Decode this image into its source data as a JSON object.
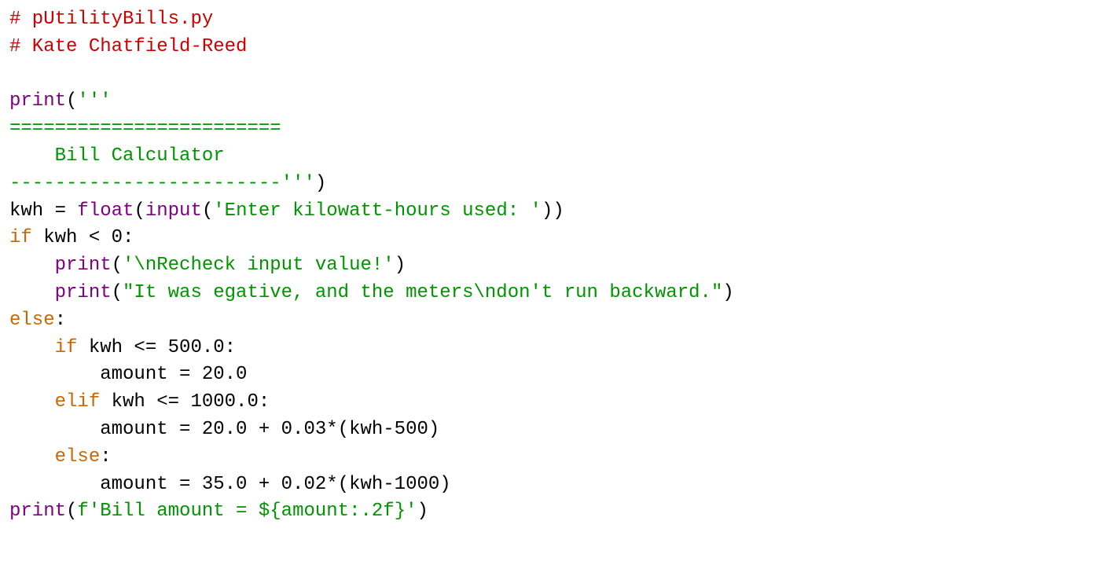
{
  "code": {
    "comment1": "# pUtilityBills.py",
    "comment2": "# Kate Chatfield-Reed",
    "blank1": "",
    "l4": {
      "print": "print",
      "paren_open": "(",
      "str": "'''"
    },
    "l5": {
      "str": "========================"
    },
    "l6": {
      "str": "    Bill Calculator"
    },
    "l7": {
      "str": "------------------------'''",
      "paren_close": ")"
    },
    "l8": {
      "lhs": "kwh = ",
      "float": "float",
      "paren1": "(",
      "input": "input",
      "paren2": "(",
      "str": "'Enter kilowatt-hours used: '",
      "close": "))"
    },
    "l9": {
      "kw": "if",
      "rest": " kwh < 0:"
    },
    "l10": {
      "indent": "    ",
      "print": "print",
      "paren_open": "(",
      "str": "'\\nRecheck input value!'",
      "paren_close": ")"
    },
    "l11": {
      "indent": "    ",
      "print": "print",
      "paren_open": "(",
      "str": "\"It was egative, and the meters\\ndon't run backward.\"",
      "paren_close": ")"
    },
    "l12": {
      "kw": "else",
      "colon": ":"
    },
    "l13": {
      "indent": "    ",
      "kw": "if",
      "rest": " kwh <= 500.0:"
    },
    "l14": {
      "text": "        amount = 20.0"
    },
    "l15": {
      "indent": "    ",
      "kw": "elif",
      "rest": " kwh <= 1000.0:"
    },
    "l16": {
      "text": "        amount = 20.0 + 0.03*(kwh-500)"
    },
    "l17": {
      "indent": "    ",
      "kw": "else",
      "colon": ":"
    },
    "l18": {
      "text": "        amount = 35.0 + 0.02*(kwh-1000)"
    },
    "l19": {
      "print": "print",
      "paren_open": "(",
      "str": "f'Bill amount = ${amount:.2f}'",
      "paren_close": ")"
    }
  }
}
